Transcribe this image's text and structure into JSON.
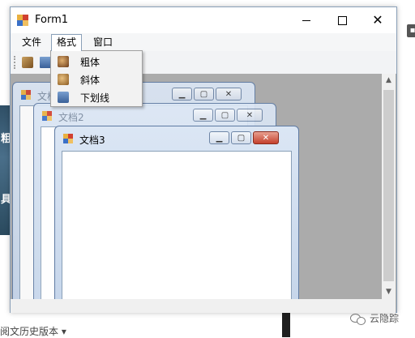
{
  "window": {
    "title": "Form1"
  },
  "menubar": {
    "items": [
      {
        "label": "文件"
      },
      {
        "label": "格式"
      },
      {
        "label": "窗口"
      }
    ]
  },
  "format_menu": {
    "items": [
      {
        "label": "粗体",
        "icon": "bold-icon"
      },
      {
        "label": "斜体",
        "icon": "italic-icon"
      },
      {
        "label": "下划线",
        "icon": "underline-icon"
      }
    ]
  },
  "mdi_children": [
    {
      "title": "文档1",
      "state": "inactive"
    },
    {
      "title": "文档2",
      "state": "inactive"
    },
    {
      "title": "文档3",
      "state": "active"
    }
  ],
  "background": {
    "left_strip_chars": [
      "粗",
      "具"
    ],
    "bottom_text": "阅文历史版本 ▾",
    "watermark": "云隐踪"
  },
  "colors": {
    "mdi_background": "#ababab",
    "menu_highlight_border": "#8aa0b8",
    "active_close_button": "#c4402c",
    "child_titlebar": "#dbe6f4"
  }
}
